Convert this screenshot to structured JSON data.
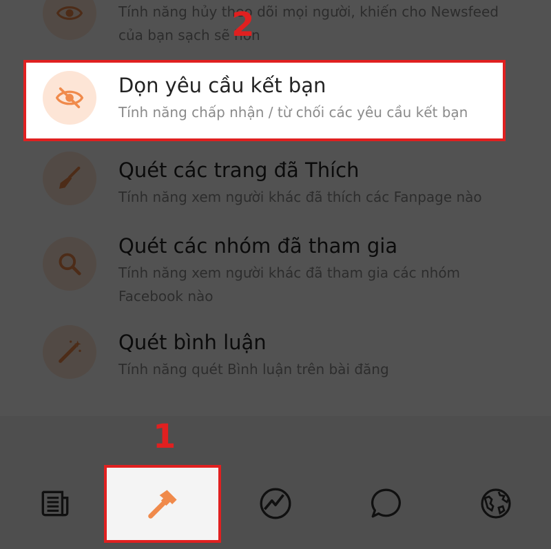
{
  "menu": {
    "items": [
      {
        "title": "",
        "desc": "Tính năng hủy theo dõi mọi người, khiến cho Newsfeed của bạn sạch sẽ hơn",
        "icon": "eye-icon"
      },
      {
        "title": "Dọn yêu cầu kết bạn",
        "desc": "Tính năng chấp nhận / từ chối các yêu cầu kết bạn",
        "icon": "eye-slash-icon"
      },
      {
        "title": "Quét các trang đã Thích",
        "desc": "Tính năng xem người khác đã thích các Fanpage nào",
        "icon": "broom-icon"
      },
      {
        "title": "Quét các nhóm đã tham gia",
        "desc": "Tính năng xem người khác đã tham gia các nhóm Facebook nào",
        "icon": "magnifier-icon"
      },
      {
        "title": "Quét bình luận",
        "desc": "Tính năng quét Bình luận trên bài đăng",
        "icon": "magic-wand-icon"
      }
    ]
  },
  "nav": {
    "items": [
      {
        "icon": "newspaper-icon",
        "active": false
      },
      {
        "icon": "hammer-icon",
        "active": true
      },
      {
        "icon": "activity-icon",
        "active": false
      },
      {
        "icon": "chat-bubble-icon",
        "active": false
      },
      {
        "icon": "globe-icon",
        "active": false
      }
    ]
  },
  "annotations": {
    "step1": "1",
    "step2": "2"
  },
  "colors": {
    "accent": "#f08a4b",
    "icon_bg": "#fde5d6",
    "highlight_border": "#e02020"
  }
}
